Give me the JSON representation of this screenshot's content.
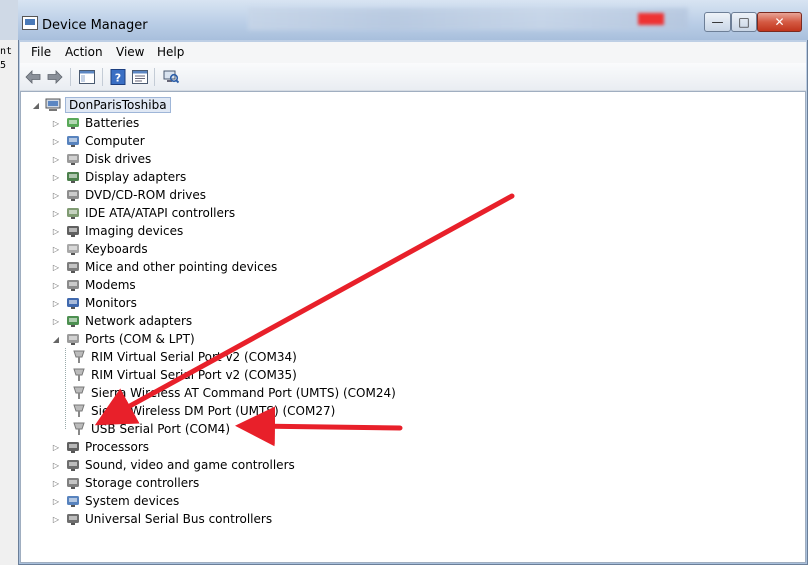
{
  "window": {
    "title": "Device Manager",
    "controls": {
      "minimize": "—",
      "maximize": "□",
      "close": "✕"
    }
  },
  "left_fragment": {
    "line1": "nt",
    "line2": "5"
  },
  "menu": [
    "File",
    "Action",
    "View",
    "Help"
  ],
  "toolbar": {
    "buttons": [
      "back-icon",
      "forward-icon",
      "show-hide-console-tree-icon",
      "help-icon",
      "properties-icon",
      "scan-hardware-icon"
    ]
  },
  "tree": {
    "root": "DonParisToshiba",
    "categories": [
      {
        "label": "Batteries",
        "icon": "battery-icon"
      },
      {
        "label": "Computer",
        "icon": "computer-icon"
      },
      {
        "label": "Disk drives",
        "icon": "disk-drive-icon"
      },
      {
        "label": "Display adapters",
        "icon": "display-adapter-icon"
      },
      {
        "label": "DVD/CD-ROM drives",
        "icon": "dvd-drive-icon"
      },
      {
        "label": "IDE ATA/ATAPI controllers",
        "icon": "ide-controller-icon"
      },
      {
        "label": "Imaging devices",
        "icon": "camera-icon"
      },
      {
        "label": "Keyboards",
        "icon": "keyboard-icon"
      },
      {
        "label": "Mice and other pointing devices",
        "icon": "mouse-icon"
      },
      {
        "label": "Modems",
        "icon": "modem-icon"
      },
      {
        "label": "Monitors",
        "icon": "monitor-icon"
      },
      {
        "label": "Network adapters",
        "icon": "network-adapter-icon"
      },
      {
        "label": "Ports (COM & LPT)",
        "icon": "port-icon",
        "expanded": true,
        "children": [
          "RIM Virtual Serial Port v2 (COM34)",
          "RIM Virtual Serial Port v2 (COM35)",
          "Sierra Wireless AT Command Port (UMTS) (COM24)",
          "Sierra Wireless DM Port (UMTS) (COM27)",
          "USB Serial Port (COM4)"
        ]
      },
      {
        "label": "Processors",
        "icon": "processor-icon"
      },
      {
        "label": "Sound, video and game controllers",
        "icon": "speaker-icon"
      },
      {
        "label": "Storage controllers",
        "icon": "storage-controller-icon"
      },
      {
        "label": "System devices",
        "icon": "system-device-icon"
      },
      {
        "label": "Universal Serial Bus controllers",
        "icon": "usb-icon"
      }
    ]
  },
  "annotation_color": "#e8202a"
}
